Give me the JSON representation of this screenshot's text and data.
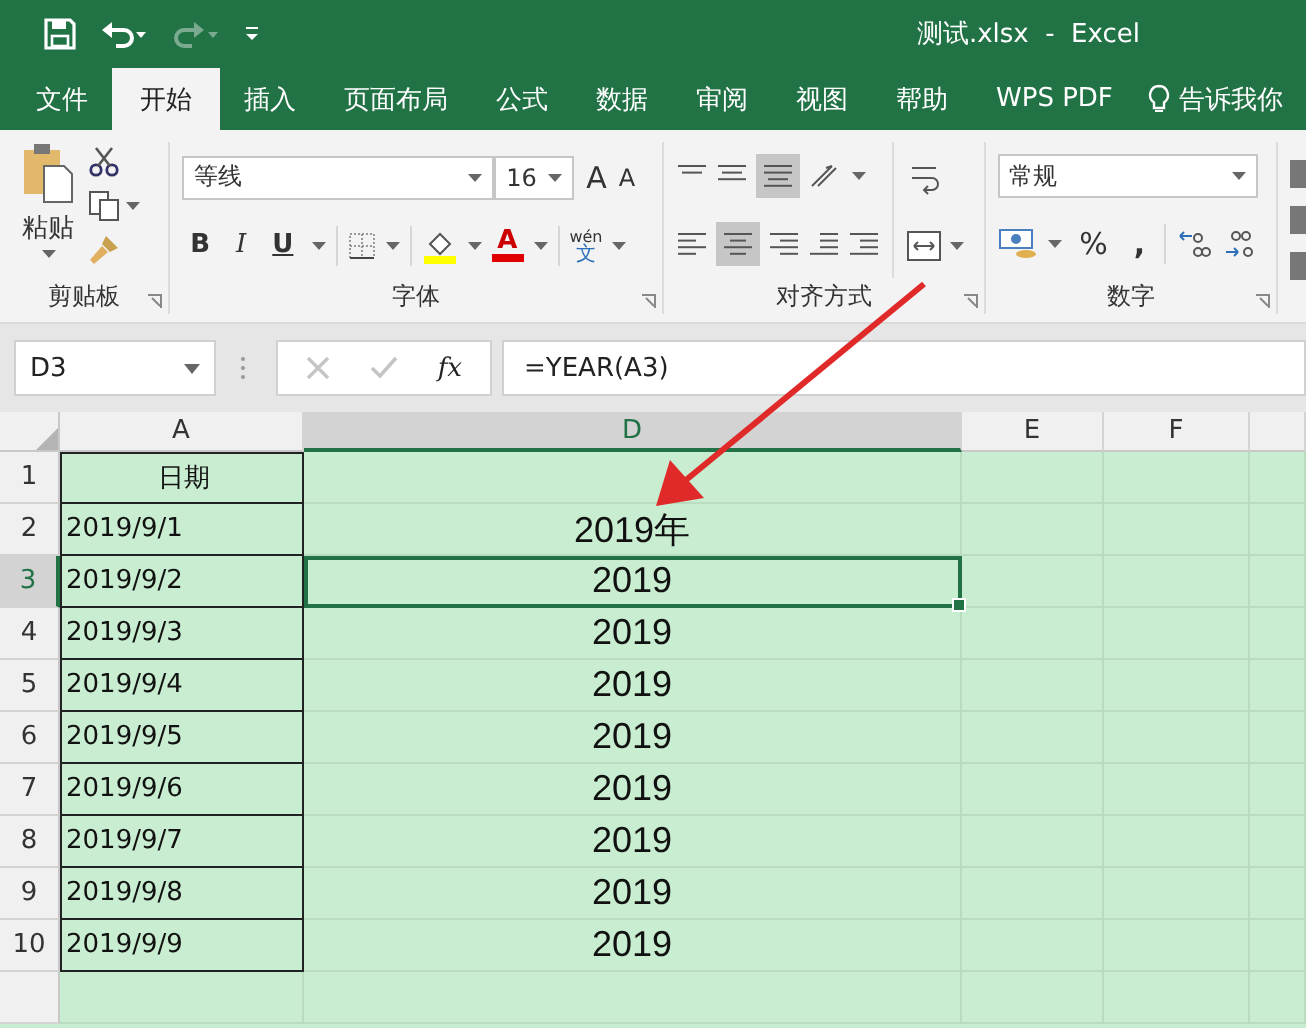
{
  "window": {
    "title": "测试.xlsx  -  Excel"
  },
  "tabs": [
    {
      "label": "文件",
      "selected": false
    },
    {
      "label": "开始",
      "selected": true
    },
    {
      "label": "插入",
      "selected": false
    },
    {
      "label": "页面布局",
      "selected": false
    },
    {
      "label": "公式",
      "selected": false
    },
    {
      "label": "数据",
      "selected": false
    },
    {
      "label": "审阅",
      "selected": false
    },
    {
      "label": "视图",
      "selected": false
    },
    {
      "label": "帮助",
      "selected": false
    },
    {
      "label": "WPS PDF",
      "selected": false
    }
  ],
  "tell_me": "告诉我你",
  "ribbon": {
    "clipboard": {
      "paste": "粘贴",
      "label": "剪贴板"
    },
    "font": {
      "name": "等线",
      "size": "16",
      "grow": "A",
      "shrink": "A",
      "bold": "B",
      "italic": "I",
      "underline": "U",
      "font_color": "A",
      "pinyin": "wén",
      "pinyin_char": "文",
      "label": "字体"
    },
    "alignment": {
      "label": "对齐方式"
    },
    "number": {
      "format": "常规",
      "percent": "%",
      "comma": ",",
      "label": "数字"
    }
  },
  "formula_bar": {
    "name_box": "D3",
    "fx": "fx",
    "formula": "=YEAR(A3)"
  },
  "columns": [
    "A",
    "D",
    "E",
    "F"
  ],
  "rows": [
    {
      "number": "1",
      "a": "日期",
      "selected": false
    },
    {
      "number": "2",
      "a": "2019/9/1",
      "d": "2019年",
      "selected": false
    },
    {
      "number": "3",
      "a": "2019/9/2",
      "d": "2019",
      "selected": true
    },
    {
      "number": "4",
      "a": "2019/9/3",
      "d": "2019",
      "selected": false
    },
    {
      "number": "5",
      "a": "2019/9/4",
      "d": "2019",
      "selected": false
    },
    {
      "number": "6",
      "a": "2019/9/5",
      "d": "2019",
      "selected": false
    },
    {
      "number": "7",
      "a": "2019/9/6",
      "d": "2019",
      "selected": false
    },
    {
      "number": "8",
      "a": "2019/9/7",
      "d": "2019",
      "selected": false
    },
    {
      "number": "9",
      "a": "2019/9/8",
      "d": "2019",
      "selected": false
    },
    {
      "number": "10",
      "a": "2019/9/9",
      "d": "2019",
      "selected": false
    }
  ]
}
